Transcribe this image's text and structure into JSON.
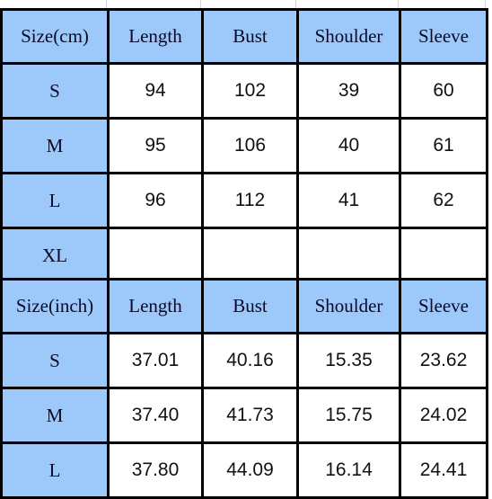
{
  "tables": [
    {
      "id": "size-chart-cm",
      "unit": "cm",
      "headers": [
        "Size(cm)",
        "Length",
        "Bust",
        "Shoulder",
        "Sleeve"
      ],
      "rows": [
        {
          "size": "S",
          "length": "94",
          "bust": "102",
          "shoulder": "39",
          "sleeve": "60"
        },
        {
          "size": "M",
          "length": "95",
          "bust": "106",
          "shoulder": "40",
          "sleeve": "61"
        },
        {
          "size": "L",
          "length": "96",
          "bust": "112",
          "shoulder": "41",
          "sleeve": "62"
        },
        {
          "size": "XL",
          "length": "",
          "bust": "",
          "shoulder": "",
          "sleeve": ""
        }
      ]
    },
    {
      "id": "size-chart-inch",
      "unit": "inch",
      "headers": [
        "Size(inch)",
        "Length",
        "Bust",
        "Shoulder",
        "Sleeve"
      ],
      "rows": [
        {
          "size": "S",
          "length": "37.01",
          "bust": "40.16",
          "shoulder": "15.35",
          "sleeve": "23.62"
        },
        {
          "size": "M",
          "length": "37.40",
          "bust": "41.73",
          "shoulder": "15.75",
          "sleeve": "24.02"
        },
        {
          "size": "L",
          "length": "37.80",
          "bust": "44.09",
          "shoulder": "16.14",
          "sleeve": "24.41"
        }
      ]
    }
  ],
  "colors": {
    "header_fill": "#9DC8FA",
    "cell_fill": "#FFFFFF",
    "border": "#000000",
    "header_text": "#0A0A28",
    "value_text": "#111111",
    "edge_strip": "#E8B489",
    "gridline": "#D4D4D4"
  }
}
